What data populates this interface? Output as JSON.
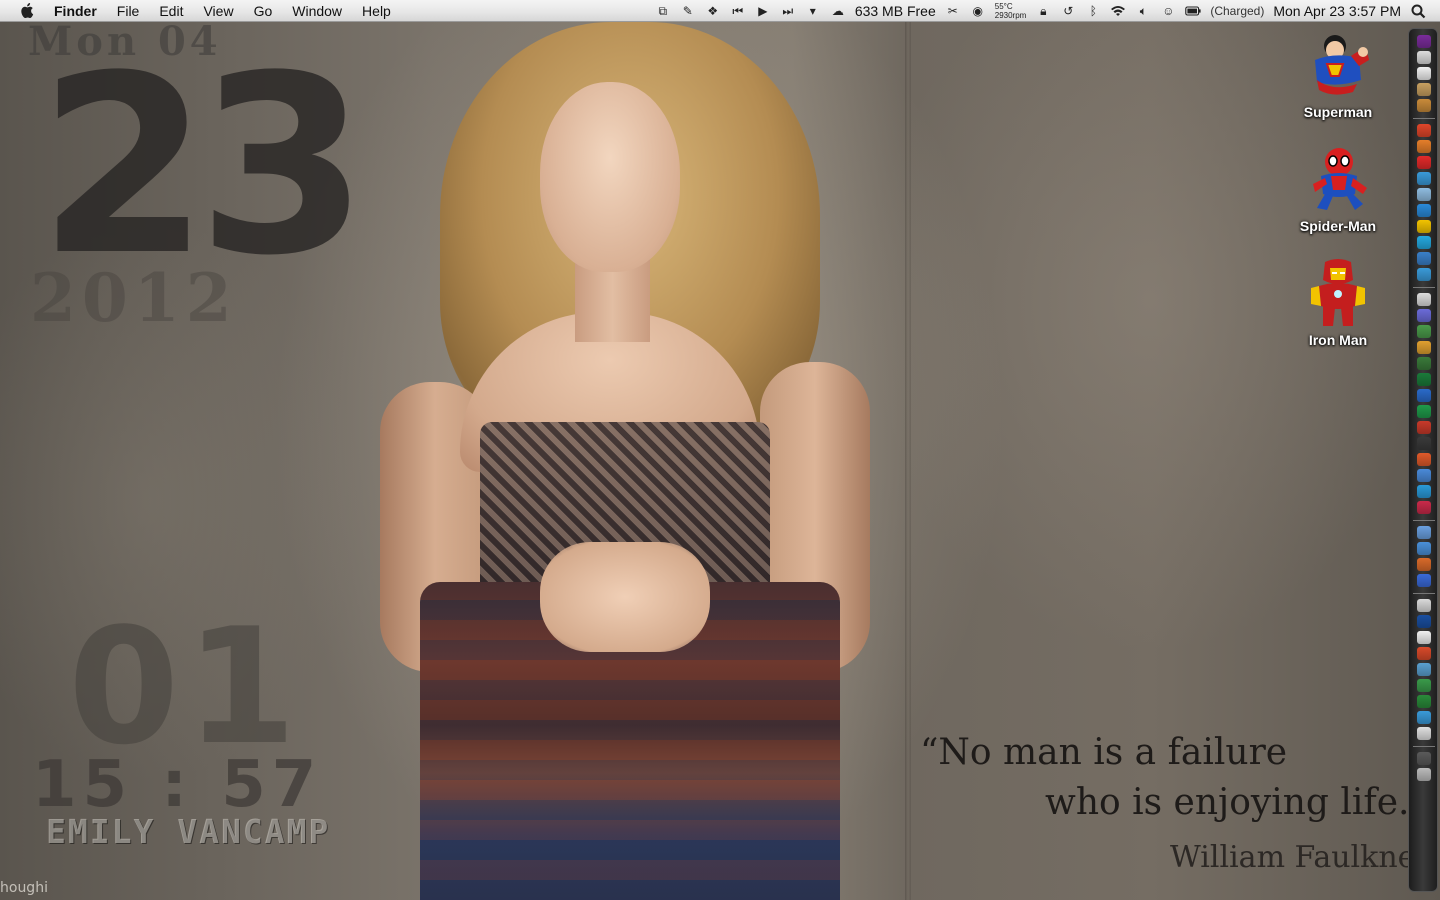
{
  "menubar": {
    "app_name": "Finder",
    "menus": [
      "File",
      "Edit",
      "View",
      "Go",
      "Window",
      "Help"
    ],
    "memory": "633 MB Free",
    "temperature": "55°C",
    "fan_speed": "2930rpm",
    "battery_status": "(Charged)",
    "datetime": "Mon Apr 23  3:57 PM"
  },
  "clock_widget": {
    "dayline": "Mon 04",
    "date": "23",
    "year": "2012",
    "minute": "01",
    "time": "15 : 57",
    "name": "EMILY VANCAMP"
  },
  "credit": "houghi",
  "quote": {
    "line1": "“No man is a failure",
    "line2": "who is enjoying life.”",
    "author": "William Faulkner"
  },
  "desktop_icons": [
    {
      "label": "Superman",
      "icon": "superman-icon"
    },
    {
      "label": "Spider-Man",
      "icon": "spiderman-icon"
    },
    {
      "label": "Iron Man",
      "icon": "ironman-icon"
    }
  ],
  "dock": {
    "position": "right",
    "item_colors": [
      "#7a2c9a",
      "#dcdcdc",
      "#f0f0f0",
      "#c8a060",
      "#c98b3a",
      "#e0462a",
      "#e57e2a",
      "#e32a2a",
      "#3a9ad9",
      "#8fbce0",
      "#2a8ad9",
      "#f2c300",
      "#24a9e0",
      "#3a80c9",
      "#3a9ad9",
      "#dddddd",
      "#6b6bd9",
      "#4a9a4a",
      "#e0a030",
      "#3a7a3a",
      "#1b7a3a",
      "#2a6ac9",
      "#1f9a4a",
      "#c83a2a",
      "#3a3a3a",
      "#e05a2a",
      "#4a8ad9",
      "#2a9ad9",
      "#c92a4a",
      "#6aa0e0",
      "#4a90d9",
      "#d96a2a",
      "#3a6ad9",
      "#dadada",
      "#1a4fa0",
      "#f0f0f0",
      "#d94a2a",
      "#5aa0d0",
      "#3a9a4a",
      "#2a8a3a",
      "#3a9ad9",
      "#e0e0e0",
      "#5a5a5a",
      "#bbbbbb"
    ]
  },
  "colors": {
    "menubar_bg": "#e6e6e6",
    "quote_text": "#1e1b19",
    "desktop_label": "#ffffff"
  }
}
